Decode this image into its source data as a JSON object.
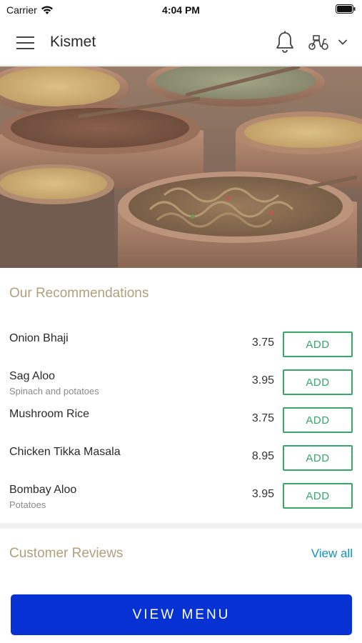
{
  "status_bar": {
    "carrier": "Carrier",
    "time": "4:04 PM"
  },
  "nav": {
    "title": "Kismet"
  },
  "recommendations": {
    "heading": "Our Recommendations",
    "items": [
      {
        "name": "Onion Bhaji",
        "description": "",
        "price": "3.75",
        "add_label": "ADD"
      },
      {
        "name": "Sag Aloo",
        "description": "Spinach and potatoes",
        "price": "3.95",
        "add_label": "ADD"
      },
      {
        "name": "Mushroom Rice",
        "description": "",
        "price": "3.75",
        "add_label": "ADD"
      },
      {
        "name": "Chicken Tikka Masala",
        "description": "",
        "price": "8.95",
        "add_label": "ADD"
      },
      {
        "name": "Bombay Aloo",
        "description": "Potatoes",
        "price": "3.95",
        "add_label": "ADD"
      }
    ]
  },
  "reviews": {
    "heading": "Customer Reviews",
    "view_all": "View all"
  },
  "footer": {
    "view_menu_label": "VIEW MENU"
  },
  "colors": {
    "accent_heading": "#b1a07e",
    "add_green": "#3aa46a",
    "link_blue": "#1c8fb8",
    "primary_button": "#0632d4"
  },
  "icons": [
    "wifi-icon",
    "battery-icon",
    "hamburger-menu-icon",
    "bell-icon",
    "scooter-icon",
    "chevron-down-icon"
  ]
}
